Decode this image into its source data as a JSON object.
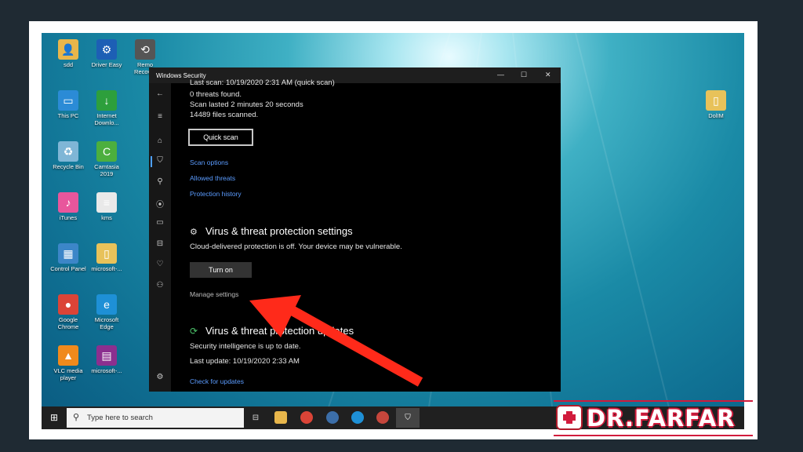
{
  "desktop_icons": [
    {
      "label": "sdd",
      "color": "#e8b64b",
      "glyph": "👤"
    },
    {
      "label": "Driver Easy",
      "color": "#1d5fb5",
      "glyph": "⚙"
    },
    {
      "label": "Remo Recover",
      "color": "#555555",
      "glyph": "⟲"
    },
    {
      "label": "This PC",
      "color": "#2b8bd6",
      "glyph": "▭"
    },
    {
      "label": "Internet Downlo...",
      "color": "#2d9f3c",
      "glyph": "↓"
    },
    {
      "label": "Recycle Bin",
      "color": "#7fb6d6",
      "glyph": "♻"
    },
    {
      "label": "Camtasia 2019",
      "color": "#4caf3e",
      "glyph": "C"
    },
    {
      "label": "iTunes",
      "color": "#e8569c",
      "glyph": "♪"
    },
    {
      "label": "kms",
      "color": "#e9e9e9",
      "glyph": "≡"
    },
    {
      "label": "Control Panel",
      "color": "#3c86c8",
      "glyph": "▦"
    },
    {
      "label": "microsoft-...",
      "color": "#e8c25a",
      "glyph": "▯"
    },
    {
      "label": "Google Chrome",
      "color": "#db4437",
      "glyph": "●"
    },
    {
      "label": "Microsoft Edge",
      "color": "#1e90d6",
      "glyph": "e"
    },
    {
      "label": "VLC media player",
      "color": "#f08a1c",
      "glyph": "▲"
    },
    {
      "label": "microsoft-...",
      "color": "#8b2f8f",
      "glyph": "▤"
    },
    {
      "label": "DolIM",
      "color": "#e8c25a",
      "glyph": "▯"
    }
  ],
  "window": {
    "title": "Windows Security",
    "minimize": "—",
    "maximize": "☐",
    "close": "✕",
    "scan_info": {
      "last_scan": "Last scan: 10/19/2020 2:31 AM (quick scan)",
      "threats": "0 threats found.",
      "duration": "Scan lasted 2 minutes 20 seconds",
      "files": "14489 files scanned."
    },
    "quick_scan_button": "Quick scan",
    "links": {
      "scan_options": "Scan options",
      "allowed_threats": "Allowed threats",
      "protection_history": "Protection history"
    },
    "settings_section": {
      "title": "Virus & threat protection settings",
      "message": "Cloud-delivered protection is off. Your device may be vulnerable.",
      "turn_on_button": "Turn on",
      "manage_link": "Manage settings"
    },
    "updates_section": {
      "title": "Virus & threat protection updates",
      "status": "Security intelligence is up to date.",
      "last_update": "Last update: 10/19/2020 2:33 AM",
      "check_link": "Check for updates"
    }
  },
  "taskbar": {
    "search_placeholder": "Type here to search"
  },
  "watermark": {
    "brand": "DR.FARFAR"
  },
  "colors": {
    "link": "#5b9cff",
    "accent_arrow": "#ff2a1a",
    "brand_red": "#d11b3c"
  }
}
